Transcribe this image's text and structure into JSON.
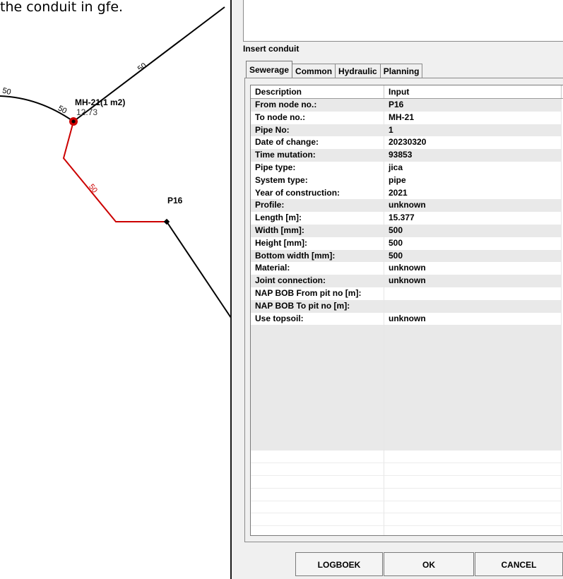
{
  "map": {
    "caption": "the conduit in gfe.",
    "nodes": {
      "mh21": {
        "label": "MH-21(1 m2)",
        "sublabel": "12.73"
      },
      "p16": {
        "label": "P16"
      }
    },
    "segment_labels": [
      "50",
      "50",
      "50",
      "50"
    ],
    "colors": {
      "pipe": "#000000",
      "selected_pipe": "#cc0000",
      "node": "#cc0000"
    }
  },
  "panel": {
    "title": "Insert conduit",
    "tabs": [
      {
        "label": "Sewerage",
        "active": true
      },
      {
        "label": "Common",
        "active": false
      },
      {
        "label": "Hydraulic",
        "active": false
      },
      {
        "label": "Planning",
        "active": false
      }
    ],
    "grid": {
      "headers": [
        "Description",
        "Input"
      ],
      "rows": [
        {
          "d": "From node no.:",
          "v": "P16"
        },
        {
          "d": "To node no.:",
          "v": "MH-21"
        },
        {
          "d": "Pipe No:",
          "v": "1"
        },
        {
          "d": "Date of change:",
          "v": "20230320"
        },
        {
          "d": "Time mutation:",
          "v": "93853"
        },
        {
          "d": "Pipe type:",
          "v": "jica"
        },
        {
          "d": "System type:",
          "v": "pipe"
        },
        {
          "d": "Year of construction:",
          "v": "2021"
        },
        {
          "d": "Profile:",
          "v": "unknown"
        },
        {
          "d": "Length [m]:",
          "v": "15.377"
        },
        {
          "d": "Width [mm]:",
          "v": "500"
        },
        {
          "d": "Height [mm]:",
          "v": "500"
        },
        {
          "d": "Bottom width [mm]:",
          "v": "500"
        },
        {
          "d": "Material:",
          "v": "unknown"
        },
        {
          "d": "Joint connection:",
          "v": "unknown"
        },
        {
          "d": "NAP BOB From pit no [m]:",
          "v": ""
        },
        {
          "d": "NAP BOB To pit no [m]:",
          "v": ""
        },
        {
          "d": "Use topsoil:",
          "v": "unknown"
        }
      ]
    },
    "buttons": {
      "logboek": "LOGBOEK",
      "ok": "OK",
      "cancel": "CANCEL"
    }
  }
}
